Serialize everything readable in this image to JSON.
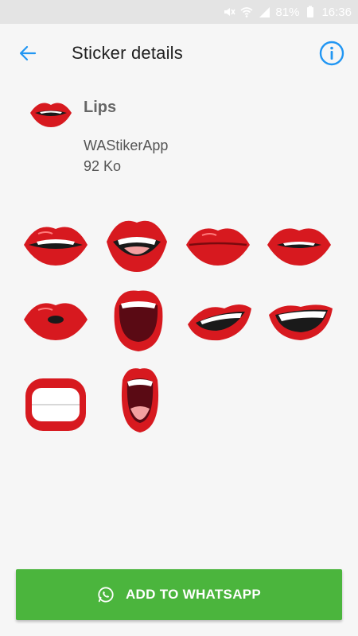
{
  "status_bar": {
    "battery": "81%",
    "time": "16:36",
    "icons": [
      "mute-icon",
      "wifi-icon",
      "signal-icon",
      "battery-icon"
    ]
  },
  "header": {
    "title": "Sticker details",
    "back_icon": "arrow-left-icon",
    "info_icon": "info-icon",
    "accent_color": "#2196f3"
  },
  "pack": {
    "name": "Lips",
    "publisher": "WAStikerApp",
    "size": "92 Ko"
  },
  "stickers": [
    {
      "name": "lips-smile-teeth"
    },
    {
      "name": "lips-bite-teeth"
    },
    {
      "name": "lips-closed"
    },
    {
      "name": "lips-teeth-pout"
    },
    {
      "name": "lips-kiss"
    },
    {
      "name": "mouth-open-shout"
    },
    {
      "name": "lips-smirk"
    },
    {
      "name": "lips-grin"
    },
    {
      "name": "lips-wide-grin"
    },
    {
      "name": "mouth-open-scream"
    }
  ],
  "action": {
    "label": "ADD TO WHATSAPP",
    "icon": "whatsapp-icon",
    "color": "#4bb53d"
  }
}
